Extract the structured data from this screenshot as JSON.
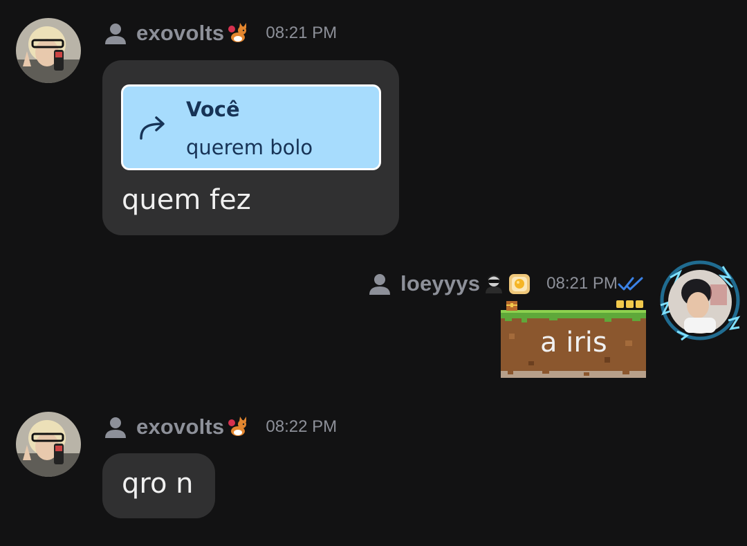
{
  "messages": [
    {
      "sender": "exovolts",
      "time": "08:21 PM",
      "badge_icon": "corgi-icon",
      "reply": {
        "author": "Você",
        "text": "querem bolo"
      },
      "text": "quem fez"
    },
    {
      "sender": "loeyyys",
      "time": "08:21 PM",
      "badge_icons": [
        "hacker-icon",
        "egg-toast-icon"
      ],
      "status_icon": "double-check-icon",
      "text": "a iris"
    },
    {
      "sender": "exovolts",
      "time": "08:22 PM",
      "badge_icon": "corgi-icon",
      "text": "qro n"
    }
  ],
  "colors": {
    "background": "#121213",
    "bubble": "#303031",
    "reply_bg": "#a7dcfd",
    "reply_text": "#173356",
    "meta_text": "#8d9099",
    "read_check": "#3b82e6"
  }
}
